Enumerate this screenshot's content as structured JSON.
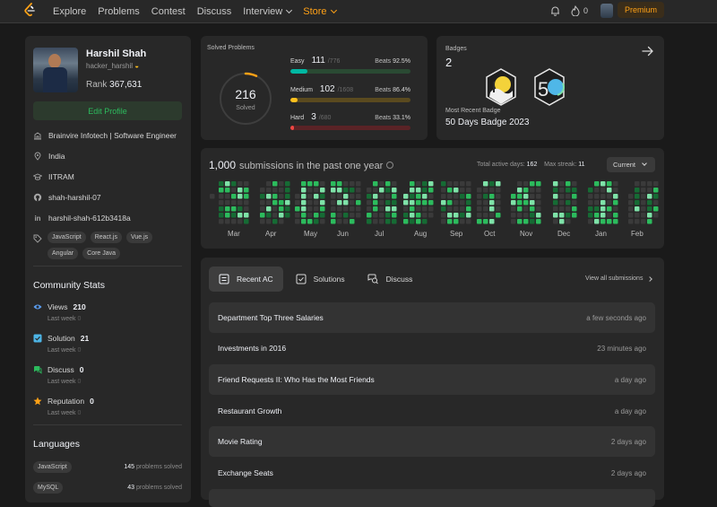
{
  "nav": {
    "items": [
      "Explore",
      "Problems",
      "Contest",
      "Discuss",
      "Interview",
      "Store"
    ],
    "streak_count": "0",
    "premium_label": "Premium",
    "accent": "#ffa116"
  },
  "profile": {
    "name": "Harshil Shah",
    "username": "hacker_harshil",
    "rank_label": "Rank",
    "rank_value": "367,631",
    "edit_label": "Edit Profile",
    "company": "Brainvire Infotech | Software Engineer",
    "location": "India",
    "school": "IITRAM",
    "github": "shah-harshil-07",
    "linkedin": "harshil-shah-612b3418a",
    "skills": [
      "JavaScript",
      "React.js",
      "Vue.js",
      "Angular",
      "Core Java"
    ]
  },
  "community": {
    "title": "Community Stats",
    "last_week_label": "Last week",
    "stats": [
      {
        "label": "Views",
        "value": "210",
        "last_week": "0",
        "color": "#5a9df0"
      },
      {
        "label": "Solution",
        "value": "21",
        "last_week": "0",
        "color": "#4db5e6"
      },
      {
        "label": "Discuss",
        "value": "0",
        "last_week": "0",
        "color": "#2cbb5d"
      },
      {
        "label": "Reputation",
        "value": "0",
        "last_week": "0",
        "color": "#ffa116"
      }
    ]
  },
  "languages": {
    "title": "Languages",
    "unit": "problems solved",
    "items": [
      {
        "name": "JavaScript",
        "count": "145"
      },
      {
        "name": "MySQL",
        "count": "43"
      }
    ]
  },
  "solved": {
    "label": "Solved Problems",
    "total": "216",
    "total_label": "Solved",
    "beats_label": "Beats",
    "difficulties": [
      {
        "name": "Easy",
        "solved": "111",
        "total": "/776",
        "beats": "92.5%",
        "ratio": 0.143,
        "color": "#00b8a3",
        "track": "#2a4a33"
      },
      {
        "name": "Medium",
        "solved": "102",
        "total": "/1608",
        "beats": "86.4%",
        "ratio": 0.063,
        "color": "#ffc01e",
        "track": "#5a4a1f"
      },
      {
        "name": "Hard",
        "solved": "3",
        "total": "/680",
        "beats": "33.1%",
        "ratio": 0.004,
        "color": "#ef4743",
        "track": "#5a2326"
      }
    ],
    "ring_ratio": 0.07
  },
  "badges": {
    "label": "Badges",
    "count": "2",
    "recent_label": "Most Recent Badge",
    "recent_name": "50 Days Badge 2023"
  },
  "heatmap": {
    "count": "1,000",
    "title_rest": "submissions in the past one year",
    "active_days_label": "Total active days:",
    "active_days": "162",
    "max_streak_label": "Max streak:",
    "max_streak": "11",
    "range": "Current",
    "months": [
      "Mar",
      "Apr",
      "May",
      "Jun",
      "Jul",
      "Aug",
      "Sep",
      "Oct",
      "Nov",
      "Dec",
      "Jan",
      "Feb"
    ]
  },
  "recent": {
    "tabs": [
      "Recent AC",
      "Solutions",
      "Discuss"
    ],
    "view_all": "View all submissions",
    "items": [
      {
        "title": "Department Top Three Salaries",
        "time": "a few seconds ago"
      },
      {
        "title": "Investments in 2016",
        "time": "23 minutes ago"
      },
      {
        "title": "Friend Requests II: Who Has the Most Friends",
        "time": "a day ago"
      },
      {
        "title": "Restaurant Growth",
        "time": "a day ago"
      },
      {
        "title": "Movie Rating",
        "time": "2 days ago"
      },
      {
        "title": "Exchange Seats",
        "time": "2 days ago"
      }
    ]
  }
}
